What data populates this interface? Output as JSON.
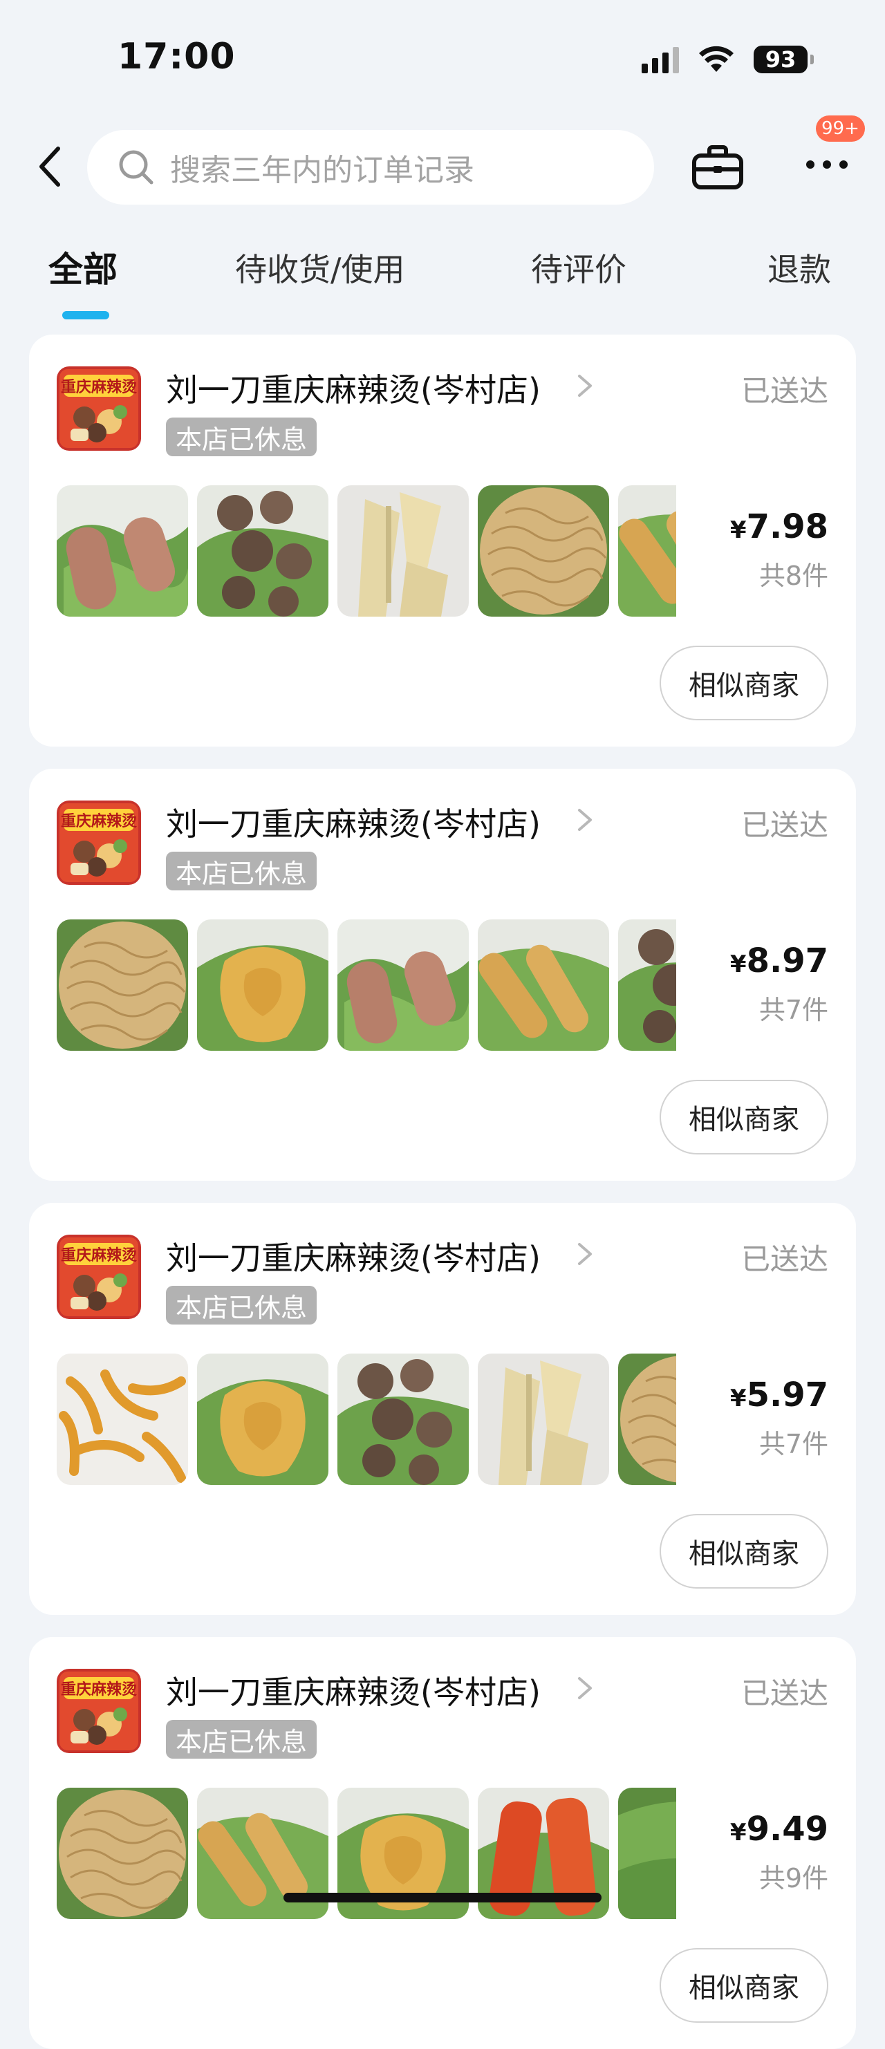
{
  "status_bar": {
    "time": "17:00",
    "battery": "93"
  },
  "search": {
    "placeholder": "搜索三年内的订单记录"
  },
  "nav": {
    "badge": "99+"
  },
  "tabs": [
    {
      "label": "全部",
      "active": true
    },
    {
      "label": "待收货/使用",
      "active": false
    },
    {
      "label": "待评价",
      "active": false
    },
    {
      "label": "退款",
      "active": false
    }
  ],
  "orders": [
    {
      "shop_name": "刘一刀重庆麻辣烫(岑村店)",
      "closed_label": "本店已休息",
      "status": "已送达",
      "currency": "¥",
      "price": "7.98",
      "count": "共8件",
      "button": "相似商家",
      "thumbs": [
        "sausage",
        "meatballs",
        "tofu-skin",
        "noodles",
        "fried-stick"
      ]
    },
    {
      "shop_name": "刘一刀重庆麻辣烫(岑村店)",
      "closed_label": "本店已休息",
      "status": "已送达",
      "currency": "¥",
      "price": "8.97",
      "count": "共7件",
      "button": "相似商家",
      "thumbs": [
        "noodles",
        "tofu-puff",
        "sausage",
        "fried-stick",
        "meatballs"
      ]
    },
    {
      "shop_name": "刘一刀重庆麻辣烫(岑村店)",
      "closed_label": "本店已休息",
      "status": "已送达",
      "currency": "¥",
      "price": "5.97",
      "count": "共7件",
      "button": "相似商家",
      "thumbs": [
        "fried-crisps",
        "tofu-puff",
        "meatballs",
        "tofu-skin",
        "noodles"
      ]
    },
    {
      "shop_name": "刘一刀重庆麻辣烫(岑村店)",
      "closed_label": "本店已休息",
      "status": "已送达",
      "currency": "¥",
      "price": "9.49",
      "count": "共9件",
      "button": "相似商家",
      "thumbs": [
        "noodles",
        "fried-stick",
        "tofu-puff",
        "crab-stick",
        "greens"
      ]
    }
  ],
  "logo": {
    "text": "重庆麻辣烫"
  }
}
